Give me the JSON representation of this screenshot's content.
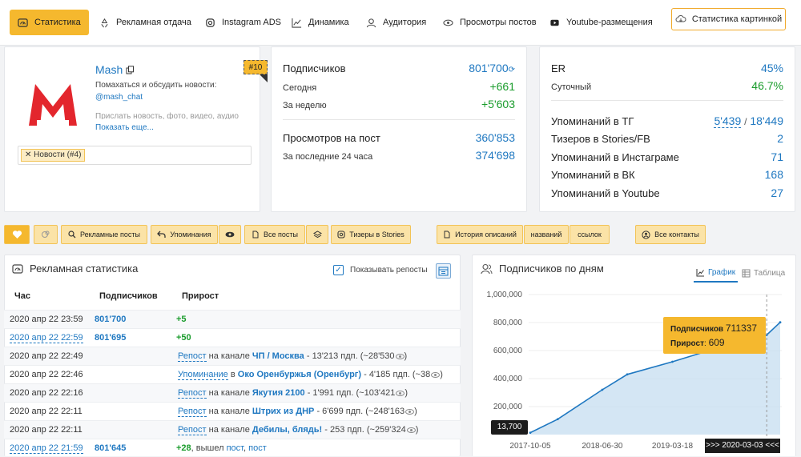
{
  "nav": {
    "tabs": [
      {
        "label": "Статистика",
        "icon": "speedometer-icon"
      },
      {
        "label": "Рекламная отдача",
        "icon": "recycle-icon"
      },
      {
        "label": "Instagram ADS",
        "icon": "instagram-icon"
      },
      {
        "label": "Динамика",
        "icon": "line-chart-icon"
      },
      {
        "label": "Аудитория",
        "icon": "user-icon"
      },
      {
        "label": "Просмотры постов",
        "icon": "eye-icon"
      },
      {
        "label": "Youtube-размещения",
        "icon": "youtube-icon"
      }
    ],
    "pic_button": "Статистика картинкой"
  },
  "channel": {
    "name": "Mash",
    "desc": "Помахаться и обсудить новости:",
    "handle": "@mash_chat",
    "desc2": "Прислать новость, фото, видео, аудио",
    "more": "Показать еще...",
    "rank": "#10",
    "tag": "Новости (#4)",
    "logo_color": "#e3262d"
  },
  "subs": {
    "subscribers_label": "Подписчиков",
    "subscribers": "801'700",
    "today_label": "Сегодня",
    "today": "+661",
    "week_label": "За неделю",
    "week": "+5'603",
    "views_label": "Просмотров на пост",
    "views": "360'853",
    "last24_label": "За последние 24 часа",
    "last24": "374'698"
  },
  "er": {
    "er_label": "ER",
    "er": "45%",
    "daily_label": "Суточный",
    "daily": "46.7%",
    "tg_label": "Упоминаний в ТГ",
    "tg_a": "5'439",
    "tg_sep": "/",
    "tg_b": "18'449",
    "stories_label": "Тизеров в Stories/FB",
    "stories": "2",
    "insta_label": "Упоминаний в Инстаграме",
    "insta": "71",
    "vk_label": "Упоминаний в ВК",
    "vk": "168",
    "yt_label": "Упоминаний в Youtube",
    "yt": "27"
  },
  "toolbar": {
    "ads_posts": "Рекламные посты",
    "mentions": "Упоминания",
    "all_posts": "Все посты",
    "stories_teasers": "Тизеры в Stories",
    "desc_history": "История описаний",
    "names": "названий",
    "links": "ссылок",
    "contacts": "Все контакты"
  },
  "ads": {
    "title": "Рекламная статистика",
    "show_reposts": "Показывать репосты",
    "col_time": "Час",
    "col_subs": "Подписчиков",
    "col_growth": "Прирост",
    "rows": [
      {
        "time": "2020 апр 22 23:59",
        "subs": "801'700",
        "growth": "+5"
      },
      {
        "time": "2020 апр 22 22:59",
        "subs": "801'695",
        "growth": "+50"
      },
      {
        "time": "2020 апр 22 22:49",
        "kind": "Репост",
        "prep": "на канале",
        "channel": "ЧП / Москва",
        "rest": "- 13'213 пдп. (~28'530"
      },
      {
        "time": "2020 апр 22 22:46",
        "kind": "Упоминание",
        "prep": "в",
        "channel": "Око Оренбуржья (Оренбург)",
        "rest": "- 4'185 пдп. (~38"
      },
      {
        "time": "2020 апр 22 22:16",
        "kind": "Репост",
        "prep": "на канале",
        "channel": "Якутия 2100",
        "rest": "- 1'991 пдп. (~103'421"
      },
      {
        "time": "2020 апр 22 22:11",
        "kind": "Репост",
        "prep": "на канале",
        "channel": "Штрих из ДНР",
        "rest": "- 6'699 пдп. (~248'163"
      },
      {
        "time": "2020 апр 22 22:11",
        "kind": "Репост",
        "prep": "на канале",
        "channel": "Дебилы, блядь!",
        "rest": "- 253 пдп. (~259'324"
      },
      {
        "time": "2020 апр 22 21:59",
        "subs": "801'645",
        "growth": "+28",
        "note": ", вышел",
        "l1": "пост",
        "sep": ",",
        "l2": "пост"
      }
    ],
    "close_paren": ")"
  },
  "daily": {
    "title": "Подписчиков по дням",
    "tab_chart": "График",
    "tab_table": "Таблица",
    "tooltip_subs_label": "Подписчиков",
    "tooltip_subs": "711337",
    "tooltip_growth_label": "Прирост",
    "tooltip_growth": "609",
    "min_badge": "13,700",
    "range_badge": ">>> 2020-03-03 <<<"
  },
  "chart_data": {
    "type": "area",
    "title": "Подписчиков по дням",
    "ylim": [
      0,
      1000000
    ],
    "y_ticks": [
      "1,000,000",
      "800,000",
      "600,000",
      "400,000",
      "200,000"
    ],
    "x_ticks": [
      "2017-10-05",
      "2018-06-30",
      "2019-03-18"
    ],
    "x": [
      "2017-10-05",
      "2018-01-15",
      "2018-06-30",
      "2018-10-01",
      "2019-03-18",
      "2019-08-01",
      "2020-03-03",
      "2020-04-22"
    ],
    "values": [
      13700,
      110000,
      320000,
      430000,
      520000,
      600000,
      711337,
      801700
    ],
    "series_color": "#1f78c1",
    "fill_color": "#c6def0"
  }
}
